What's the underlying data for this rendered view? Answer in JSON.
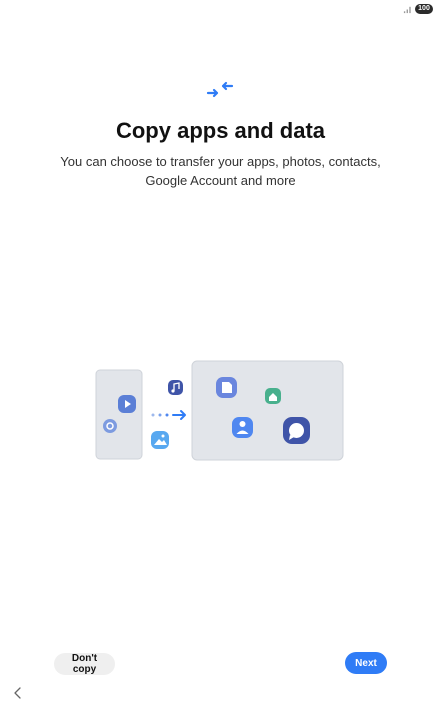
{
  "status_bar": {
    "battery_level": "100",
    "signal_icon": "signal-icon"
  },
  "header": {
    "icon": "transfer-arrows-icon",
    "title": "Copy apps and data"
  },
  "description": "You can choose to transfer your apps, photos, contacts, Google Account and more",
  "illustration": {
    "source_device_icons": [
      "play-icon",
      "settings-icon"
    ],
    "floating_icons": [
      "music-icon",
      "image-icon"
    ],
    "target_device_icons": [
      "document-icon",
      "home-icon",
      "contact-icon",
      "chat-icon"
    ]
  },
  "buttons": {
    "dont_copy_label": "Don't copy",
    "next_label": "Next"
  },
  "navigation": {
    "back_icon": "back-chevron-icon"
  },
  "colors": {
    "accent": "#2f7cf6",
    "icon_blue": "#5b7fd6",
    "icon_teal": "#48b08d",
    "device_fill": "#e2e5ea"
  }
}
